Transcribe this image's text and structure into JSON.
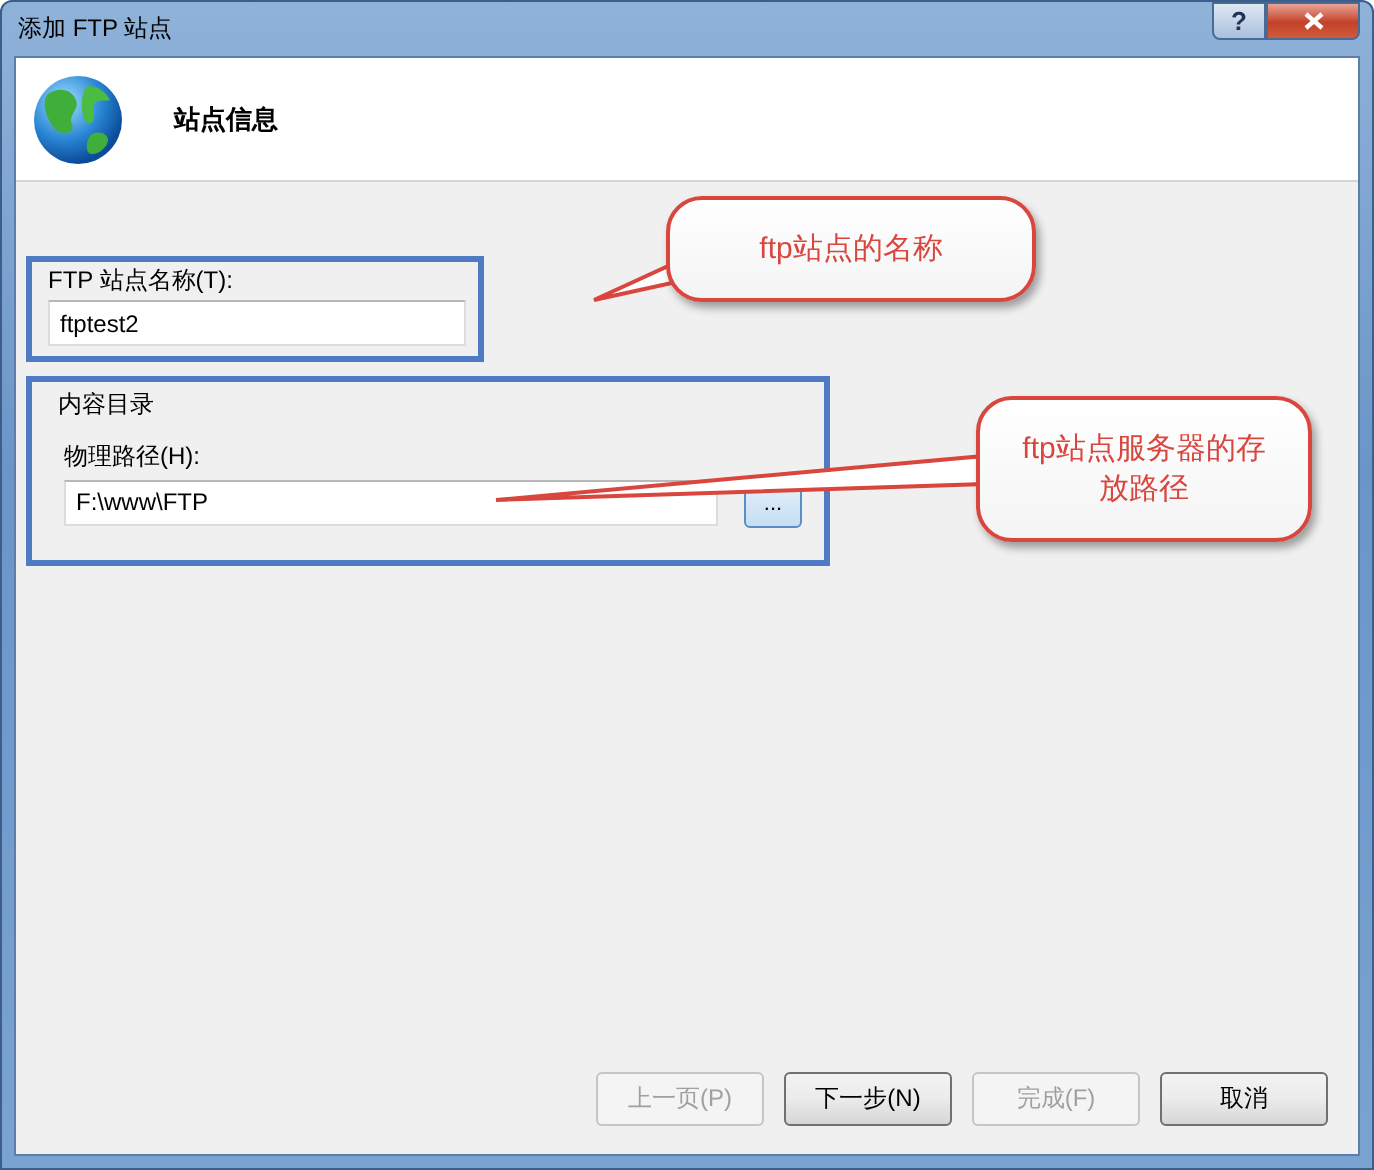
{
  "window": {
    "title": "添加 FTP 站点",
    "help": "?"
  },
  "header": {
    "title": "站点信息"
  },
  "site_name": {
    "label": "FTP 站点名称(T):",
    "value": "ftptest2"
  },
  "content_directory": {
    "legend": "内容目录",
    "path_label": "物理路径(H):",
    "path_value": "F:\\www\\FTP",
    "browse": "..."
  },
  "buttons": [
    {
      "label": "上一页(P)",
      "disabled": true
    },
    {
      "label": "下一步(N)",
      "disabled": false
    },
    {
      "label": "完成(F)",
      "disabled": true
    },
    {
      "label": "取消",
      "disabled": false
    }
  ],
  "callouts": [
    {
      "text": "ftp站点的名称"
    },
    {
      "text": "ftp站点服务器的存放路径"
    }
  ]
}
